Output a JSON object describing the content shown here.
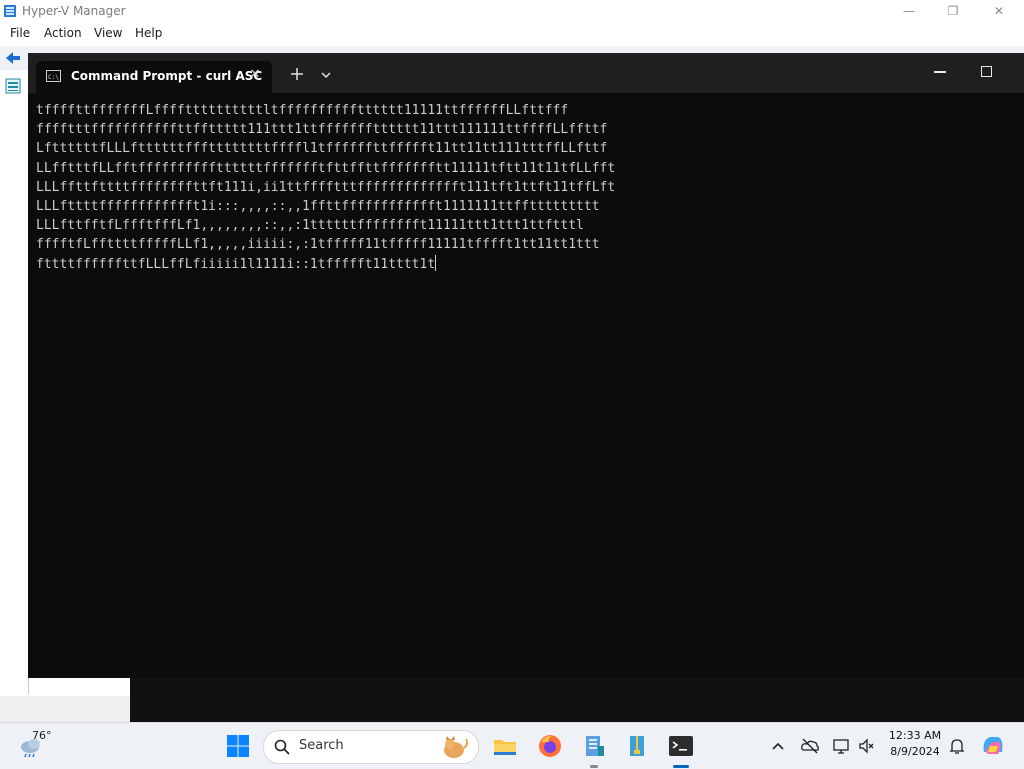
{
  "hyperv": {
    "title": "Hyper-V Manager",
    "menu": [
      "File",
      "Action",
      "View",
      "Help"
    ],
    "window_controls": {
      "minimize": "—",
      "restore": "❐",
      "close": "✕"
    }
  },
  "cmd": {
    "tab_title": "Command Prompt - curl  ASC",
    "close_glyph": "✕",
    "lines": [
      "tffffttfffffffLffffttttttttttltfffffffffftttttt11111ttffffffLLfttfff",
      "fffftttfffffffffffttffttttt111ttt1ttffffffftttttt11ttt111111ttffffLLffttf",
      "LfttttttfLLLfttttttfffttttttttffffl1tffffffttffffft11tt11tt111tttffLLfttf",
      "LLfftttfLLfftffffffffffttttttffffffftfttffttffffffftt11111tftt11t11tfLLfft",
      "LLLffttfttttffffffffttft111i,ii1ttfffftttffffffffffffft111tft1ttft11tffLft",
      "LLLfttttfffffffffffft1i:::,,,,::,,1ffttfffffffffffft1111111ttffttttttttt",
      "LLLfttfftfLffftfffLf1,,,,,,,,::,,:1ttttttfffffffft11111ttt1ttt1ttftttl",
      "fffftfLffttttfffffLLf1,,,,,iiiii:,:1tfffff11tfffff11111tfffft1tt11tt1ttt",
      "fttttffffffttfLLLffLfiiiii1l1111i::1tffffft11tttt1t"
    ]
  },
  "taskbar": {
    "temperature": "76°",
    "search_placeholder": "Search",
    "time": "12:33 AM",
    "date": "8/9/2024"
  },
  "colors": {
    "terminal_bg": "#0c0c0c",
    "terminal_text": "#cccccc",
    "taskbar_bg": "#eef1f6",
    "accent": "#0067c0"
  },
  "icons": [
    "hyperv-app-icon",
    "back-arrow-icon",
    "cmd-tab-icon",
    "new-tab-icon",
    "dropdown-icon",
    "weather-icon",
    "windows-start-icon",
    "search-icon",
    "file-explorer-icon",
    "firefox-icon",
    "hyperv-taskbar-icon",
    "zip-folder-icon",
    "terminal-icon",
    "chevron-up-icon",
    "onedrive-icon",
    "network-icon",
    "volume-icon",
    "notification-bell-icon",
    "copilot-icon"
  ]
}
